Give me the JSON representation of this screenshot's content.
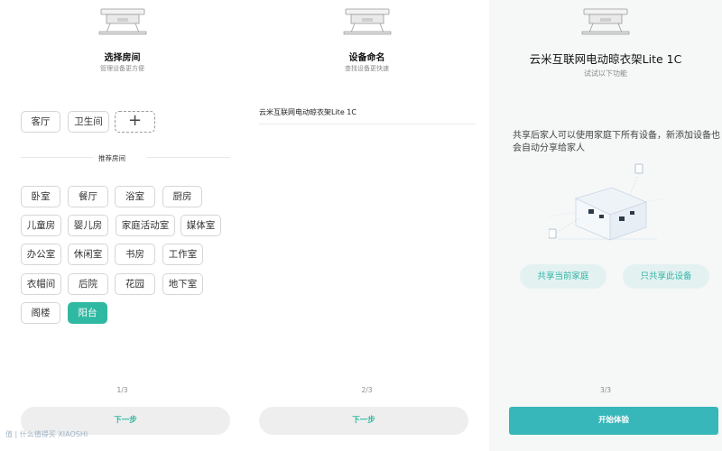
{
  "step1": {
    "title": "选择房间",
    "subtitle": "管理设备更方便",
    "existing_rooms": [
      "客厅",
      "卫生间"
    ],
    "add_symbol": "+",
    "recommend_label": "推荐房间",
    "recommended_rooms": [
      "卧室",
      "餐厅",
      "浴室",
      "厨房",
      "儿童房",
      "婴儿房",
      "家庭活动室",
      "媒体室",
      "办公室",
      "休闲室",
      "书房",
      "工作室",
      "衣帽间",
      "后院",
      "花园",
      "地下室",
      "阁楼",
      "阳台"
    ],
    "selected_room": "阳台",
    "pager": "1/3",
    "next_label": "下一步"
  },
  "step2": {
    "title": "设备命名",
    "subtitle": "查找设备更快速",
    "device_name": "云米互联网电动晾衣架Lite 1C",
    "pager": "2/3",
    "next_label": "下一步"
  },
  "step3": {
    "title": "云米互联网电动晾衣架Lite 1C",
    "subtitle": "试试以下功能",
    "share_desc": "共享后家人可以使用家庭下所有设备，新添加设备也会自动分享给家人",
    "share_home_label": "共享当前家庭",
    "share_device_label": "只共享此设备",
    "pager": "3/3",
    "start_label": "开始体验"
  },
  "watermark": "值 | 什么值得买 XIAOSHI",
  "colors": {
    "accent": "#2fb9a2",
    "primary_button": "#37b7b9",
    "share_button_bg": "#e3f2f1"
  }
}
